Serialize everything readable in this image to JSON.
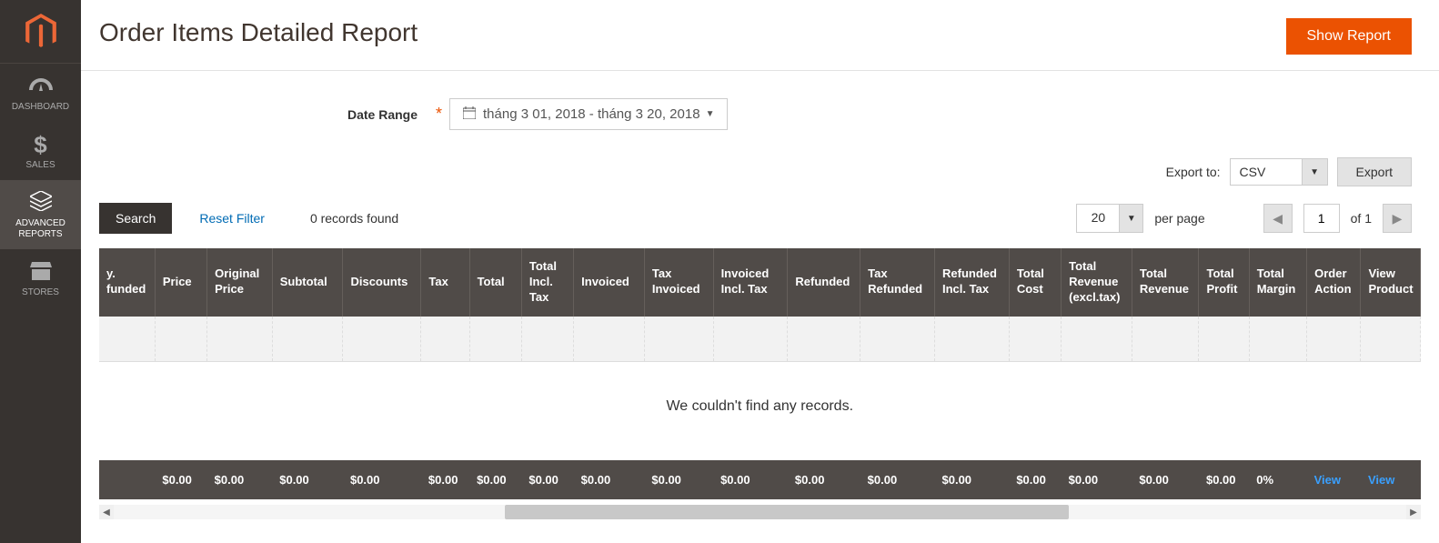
{
  "sidebar": {
    "items": [
      {
        "icon": "dashboard",
        "label": "DASHBOARD"
      },
      {
        "icon": "dollar",
        "label": "SALES"
      },
      {
        "icon": "layers",
        "label": "ADVANCED REPORTS",
        "active": true
      },
      {
        "icon": "store",
        "label": "STORES"
      }
    ]
  },
  "header": {
    "title": "Order Items Detailed Report",
    "show_report": "Show Report"
  },
  "filters": {
    "date_range_label": "Date Range",
    "date_range_value": "tháng 3 01, 2018 - tháng 3 20, 2018"
  },
  "export": {
    "label": "Export to:",
    "format": "CSV",
    "button": "Export"
  },
  "grid": {
    "search_btn": "Search",
    "reset_btn": "Reset Filter",
    "records_found": "0 records found",
    "per_page_value": "20",
    "per_page_label": "per page",
    "page_current": "1",
    "page_of": "of 1",
    "columns": [
      "y. funded",
      "Price",
      "Original Price",
      "Subtotal",
      "Discounts",
      "Tax",
      "Total",
      "Total Incl. Tax",
      "Invoiced",
      "Tax Invoiced",
      "Invoiced Incl. Tax",
      "Refunded",
      "Tax Refunded",
      "Refunded Incl. Tax",
      "Total Cost",
      "Total Revenue (excl.tax)",
      "Total Revenue",
      "Total Profit",
      "Total Margin",
      "Order Action",
      "View Product"
    ],
    "empty_message": "We couldn't find any records.",
    "footer": [
      "",
      "$0.00",
      "$0.00",
      "$0.00",
      "$0.00",
      "$0.00",
      "$0.00",
      "$0.00",
      "$0.00",
      "$0.00",
      "$0.00",
      "$0.00",
      "$0.00",
      "$0.00",
      "$0.00",
      "$0.00",
      "$0.00",
      "$0.00",
      "0%",
      "View",
      "View"
    ]
  }
}
